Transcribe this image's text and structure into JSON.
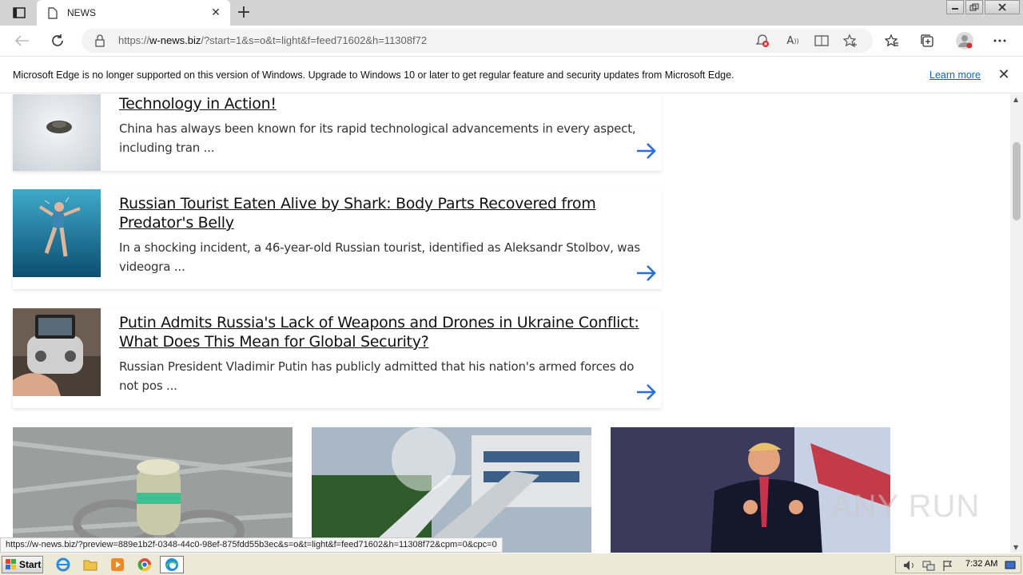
{
  "browser": {
    "tab_title": "NEWS",
    "url_prefix": "https://",
    "url_host": "w-news.biz",
    "url_rest": "/?start=1&s=o&t=light&f=feed71602&h=11308f72",
    "status_link": "https://w-news.biz/?preview=889e1b2f-0348-44c0-98ef-875fdd55b3ec&s=o&t=light&f=feed71602&h=11308f72&cpm=0&cpc=0"
  },
  "infobar": {
    "message": "Microsoft Edge is no longer supported on this version of Windows. Upgrade to Windows 10 or later to get regular feature and security updates from Microsoft Edge.",
    "learn_more": "Learn more"
  },
  "articles": [
    {
      "headline": "Technology in Action!",
      "summary": "China has always been known for its rapid technological advancements in every aspect, including tran ..."
    },
    {
      "headline": "Russian Tourist Eaten Alive by Shark: Body Parts Recovered from Predator's Belly",
      "summary": "In a shocking incident, a 46-year-old Russian tourist, identified as Aleksandr Stolbov, was videogra ..."
    },
    {
      "headline": "Putin Admits Russia's Lack of Weapons and Drones in Ukraine Conflict: What Does This Mean for Global Security?",
      "summary": "Russian President Vladimir Putin has publicly admitted that his nation's armed forces do not pos ..."
    }
  ],
  "watermark": "ANY RUN",
  "taskbar": {
    "start_label": "Start",
    "clock": "7:32 AM"
  },
  "colors": {
    "accent_link": "#0b66c3",
    "arrow": "#2b6fd6"
  }
}
